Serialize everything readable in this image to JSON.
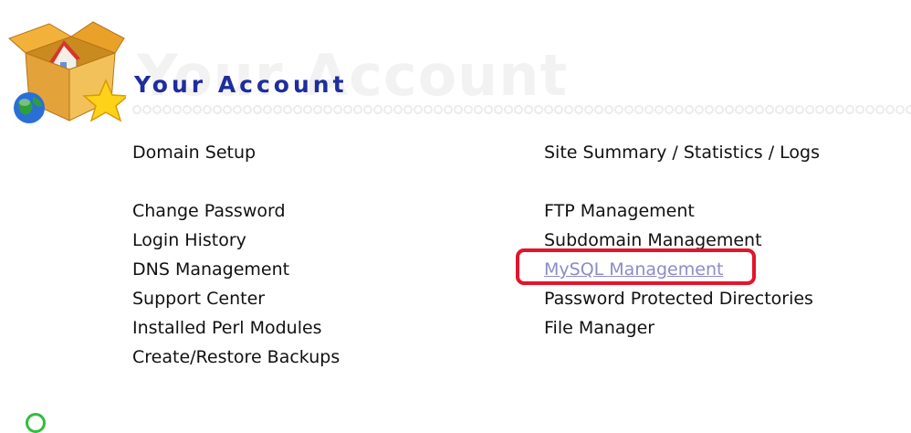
{
  "header": {
    "watermark": "Your Account",
    "title": "Your Account"
  },
  "menu": {
    "left": [
      {
        "label": "Domain Setup"
      },
      {
        "label": "Change Password"
      },
      {
        "label": "Login History"
      },
      {
        "label": "DNS Management"
      },
      {
        "label": "Support Center"
      },
      {
        "label": "Installed Perl Modules"
      },
      {
        "label": "Create/Restore Backups"
      }
    ],
    "right": [
      {
        "label": "Site Summary / Statistics / Logs"
      },
      {
        "label": "FTP Management"
      },
      {
        "label": "Subdomain Management"
      },
      {
        "label": "MySQL Management",
        "state": "visited",
        "highlighted": true
      },
      {
        "label": "Password Protected Directories"
      },
      {
        "label": "File Manager"
      }
    ]
  },
  "colors": {
    "title": "#1e2d9e",
    "visited_link": "#8c8cc6",
    "highlight": "#e3142b"
  },
  "icons": {
    "account": "house-in-box-globe-star-icon"
  }
}
